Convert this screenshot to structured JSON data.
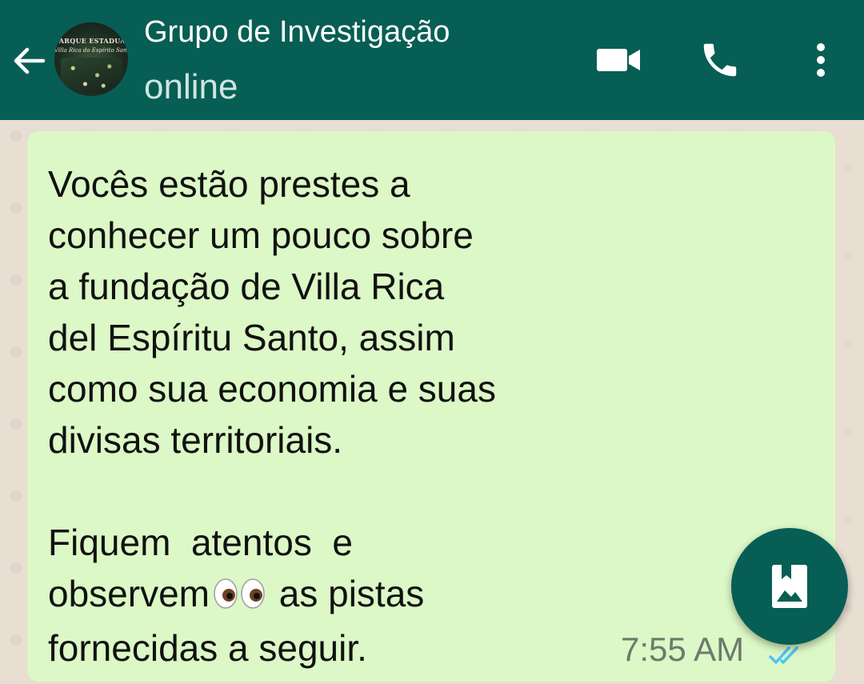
{
  "header": {
    "title": "Grupo de Investigação",
    "status": "online",
    "avatar_line1": "PARQUE ESTADUAL",
    "avatar_line2": "Villa Rica do Espírito Santo",
    "colors": {
      "bar": "#075e54",
      "title": "#ffffff",
      "status": "#cfe5e0"
    },
    "icons": [
      "back-arrow-icon",
      "video-call-icon",
      "phone-icon",
      "more-vertical-icon"
    ]
  },
  "message": {
    "text_part1": "Vocês estão prestes a\nconhecer um pouco sobre\na fundação de Villa Rica\ndel Espíritu Santo, assim\ncomo sua economia e suas\ndivisas territoriais.\n\nFiquem  atentos  e\nobservem",
    "text_part2": " as pistas\nfornecidas a seguir.",
    "emoji": "eyes-emoji",
    "time": "7:55 AM",
    "status_icon": "double-check-read-icon",
    "colors": {
      "bubble": "#dcf8c6",
      "text": "#111111",
      "ticks": "#4fc3f7"
    }
  },
  "fab": {
    "icon": "gallery-image-icon",
    "color": "#075e54"
  }
}
